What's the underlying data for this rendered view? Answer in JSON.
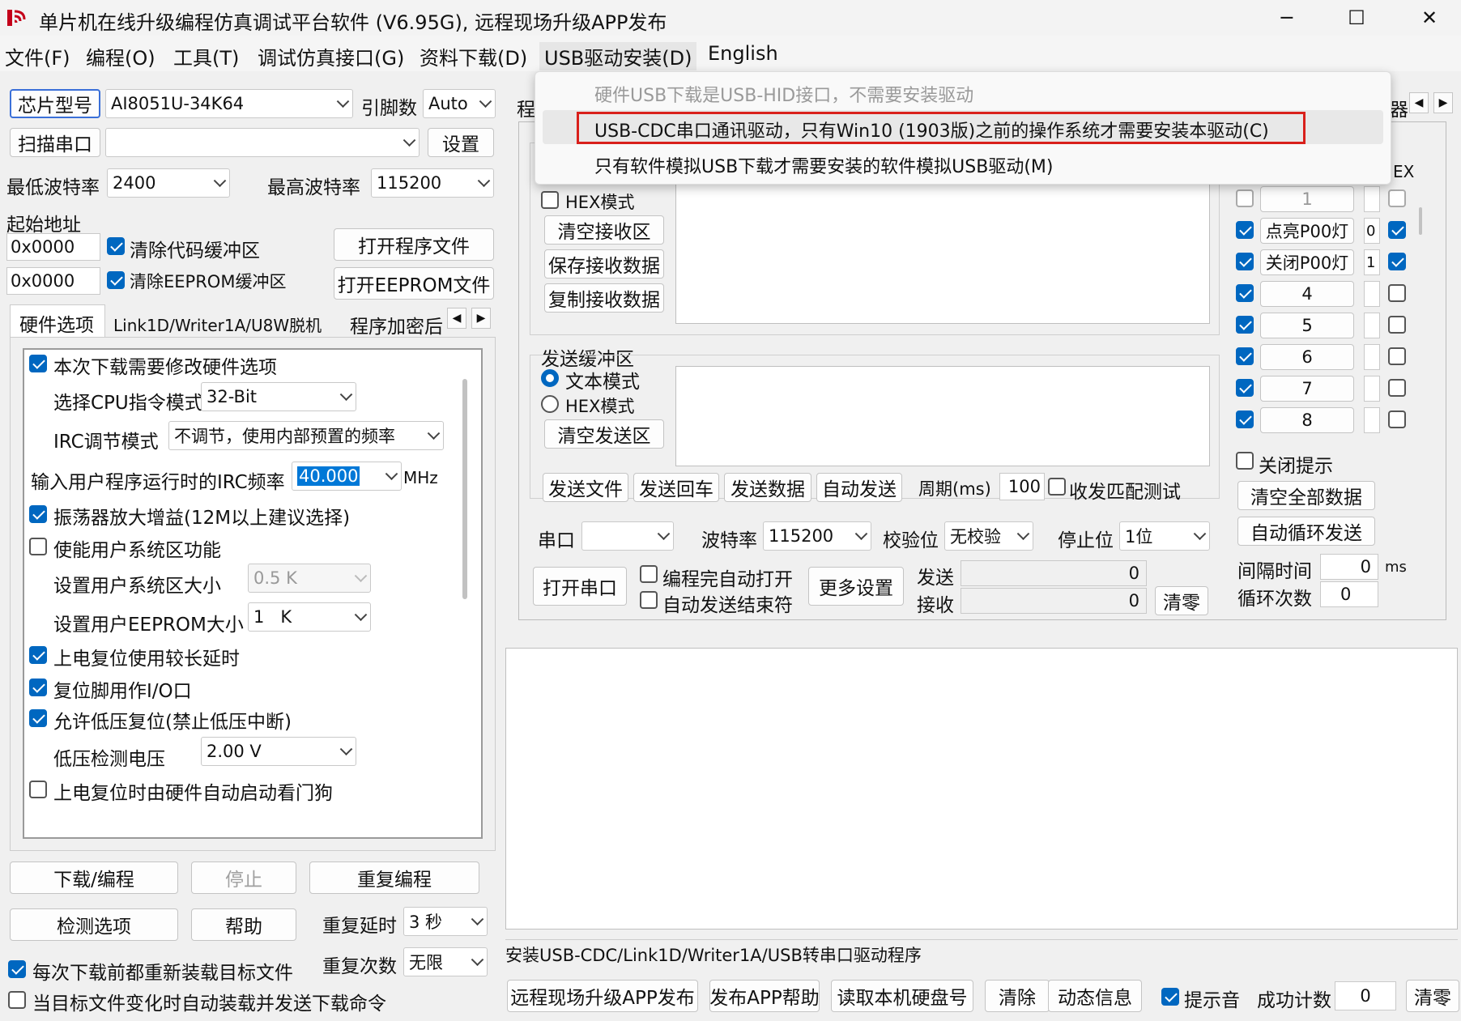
{
  "window": {
    "title": "单片机在线升级编程仿真调试平台软件 (V6.95G), 远程现场升级APP发布",
    "minimize": "─",
    "maximize": "☐",
    "close": "✕"
  },
  "menu": [
    "文件(F)",
    "编程(O)",
    "工具(T)",
    "调试仿真接口(G)",
    "资料下载(D)",
    "USB驱动安装(D)",
    "English"
  ],
  "dropdown": {
    "items": [
      "硬件USB下载是USB-HID接口，不需要安装驱动",
      "USB-CDC串口通讯驱动，只有Win10 (1903版)之前的操作系统才需要安装本驱动(C)",
      "只有软件模拟USB下载才需要安装的软件模拟USB驱动(M)"
    ]
  },
  "left": {
    "chip_btn": "芯片型号",
    "chip_value": "AI8051U-34K64",
    "pins_label": "引脚数",
    "pins_value": "Auto",
    "scan_btn": "扫描串口",
    "set_btn": "设置",
    "min_baud_label": "最低波特率",
    "min_baud": "2400",
    "max_baud_label": "最高波特率",
    "max_baud": "115200",
    "start_addr_label": "起始地址",
    "addr1": "0x0000",
    "clear_code": "清除代码缓冲区",
    "open_prog": "打开程序文件",
    "addr2": "0x0000",
    "clear_eeprom": "清除EEPROM缓冲区",
    "open_eeprom": "打开EEPROM文件",
    "tabs": [
      "硬件选项",
      "Link1D/Writer1A/U8W脱机",
      "程序加密后"
    ],
    "opt_modify": "本次下载需要修改硬件选项",
    "cpu_mode_label": "选择CPU指令模式",
    "cpu_mode": "32-Bit",
    "irc_mode_label": "IRC调节模式",
    "irc_mode": "不调节，使用内部预置的频率",
    "irc_freq_label": "输入用户程序运行时的IRC频率",
    "irc_freq": "40.000",
    "irc_unit": "MHz",
    "osc_gain": "振荡器放大增益(12M以上建议选择)",
    "user_sys": "使能用户系统区功能",
    "sys_size_label": "设置用户系统区大小",
    "sys_size": "0.5 K",
    "eeprom_size_label": "设置用户EEPROM大小",
    "eeprom_size": "1   K",
    "long_delay": "上电复位使用较长延时",
    "reset_io": "复位脚用作I/O口",
    "low_volt_reset": "允许低压复位(禁止低压中断)",
    "low_volt_label": "低压检测电压",
    "low_volt": "2.00 V",
    "watchdog": "上电复位时由硬件自动启动看门狗",
    "download_btn": "下载/编程",
    "stop_btn": "停止",
    "reprog_btn": "重复编程",
    "check_btn": "检测选项",
    "help_btn": "帮助",
    "repeat_delay_label": "重复延时",
    "repeat_delay": "3 秒",
    "repeat_count_label": "重复次数",
    "repeat_count": "无限",
    "reload_each": "每次下载前都重新装载目标文件",
    "auto_reload": "当目标文件变化时自动装载并发送下载命令"
  },
  "serial": {
    "partial_tab": "程",
    "hex_mode_rx": "HEX模式",
    "clear_rx": "清空接收区",
    "save_rx": "保存接收数据",
    "copy_rx": "复制接收数据",
    "send_buf_label": "发送缓冲区",
    "text_mode": "文本模式",
    "hex_mode_tx": "HEX模式",
    "clear_tx": "清空发送区",
    "send_file": "发送文件",
    "send_cr": "发送回车",
    "send_data": "发送数据",
    "auto_send": "自动发送",
    "period_label": "周期(ms)",
    "period": "100",
    "echo_test": "收发匹配测试",
    "port_label": "串口",
    "baud_label": "波特率",
    "baud": "115200",
    "parity_label": "校验位",
    "parity": "无校验",
    "stop_label": "停止位",
    "stop": "1位",
    "open_port": "打开串口",
    "auto_open": "编程完自动打开",
    "auto_end": "自动发送结束符",
    "more_settings": "更多设置",
    "send_label": "发送",
    "send_count": "0",
    "recv_label": "接收",
    "recv_count": "0",
    "clear_count": "清零"
  },
  "multi": {
    "tab_partial": "器",
    "hex_header": "EX",
    "rows": [
      {
        "label": "1",
        "num": ""
      },
      {
        "label": "点亮P00灯",
        "num": "0"
      },
      {
        "label": "关闭P00灯",
        "num": "1"
      },
      {
        "label": "4",
        "num": ""
      },
      {
        "label": "5",
        "num": ""
      },
      {
        "label": "6",
        "num": ""
      },
      {
        "label": "7",
        "num": ""
      },
      {
        "label": "8",
        "num": ""
      }
    ],
    "close_tip": "关闭提示",
    "clear_all": "清空全部数据",
    "auto_loop": "自动循环发送",
    "interval_label": "间隔时间",
    "interval": "0",
    "interval_unit": "ms",
    "loop_label": "循环次数",
    "loop": "0"
  },
  "status": {
    "text": "安装USB-CDC/Link1D/Writer1A/USB转串口驱动程序"
  },
  "bottom": {
    "remote_btn": "远程现场升级APP发布",
    "app_help": "发布APP帮助",
    "read_disk": "读取本机硬盘号",
    "clear": "清除",
    "dyn_info": "动态信息",
    "beep": "提示音",
    "success_label": "成功计数",
    "success_count": "0",
    "reset": "清零"
  }
}
